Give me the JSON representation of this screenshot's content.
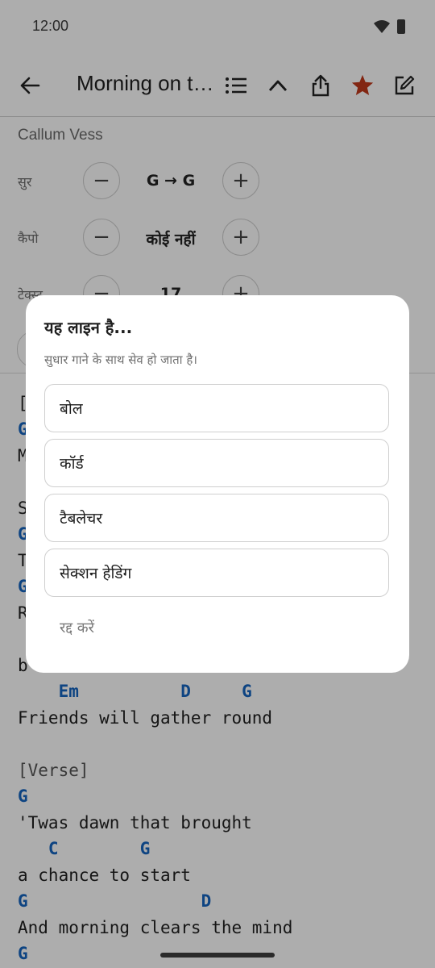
{
  "status": {
    "time": "12:00"
  },
  "toolbar": {
    "title": "Morning on the Hill",
    "back_icon": "arrow-left-icon",
    "list_icon": "list-icon",
    "collapse_icon": "chevron-up-icon",
    "share_icon": "share-icon",
    "favorite_icon": "star-icon",
    "edit_icon": "edit-icon",
    "favorite_color": "#c0391b"
  },
  "song": {
    "artist": "Callum Vess"
  },
  "controls": {
    "key": {
      "label": "सुर",
      "value": "G → G",
      "minus": "−",
      "plus": "+"
    },
    "capo": {
      "label": "कैपो",
      "value": "कोई नहीं",
      "minus": "−",
      "plus": "+"
    },
    "text": {
      "label": "टेक्स्ट",
      "value": "17",
      "minus": "−",
      "plus": "+"
    }
  },
  "sheet": {
    "chord_color": "#1565c0",
    "hidden_lines": [
      "[",
      "G",
      "M",
      "S",
      "G",
      "T",
      "G",
      "R",
      "b"
    ],
    "lines": [
      {
        "type": "chord",
        "text": "    Em          D     G"
      },
      {
        "type": "lyric",
        "text": "Friends will gather round"
      },
      {
        "type": "section",
        "text": "[Verse]"
      },
      {
        "type": "chord",
        "text": "G"
      },
      {
        "type": "lyric",
        "text": "'Twas dawn that brought"
      },
      {
        "type": "chord",
        "text": "   C        G"
      },
      {
        "type": "lyric",
        "text": "a chance to start"
      },
      {
        "type": "chord",
        "text": "G                 D"
      },
      {
        "type": "lyric",
        "text": "And morning clears the mind"
      },
      {
        "type": "chord",
        "text": "G"
      }
    ]
  },
  "dialog": {
    "title": "यह लाइन है...",
    "subtitle": "सुधार गाने के साथ सेव हो जाता है।",
    "options": [
      {
        "label": "बोल"
      },
      {
        "label": "कॉर्ड"
      },
      {
        "label": "टैबलेचर"
      },
      {
        "label": "सेक्शन हेडिंग"
      }
    ],
    "cancel": "रद्द करें"
  }
}
